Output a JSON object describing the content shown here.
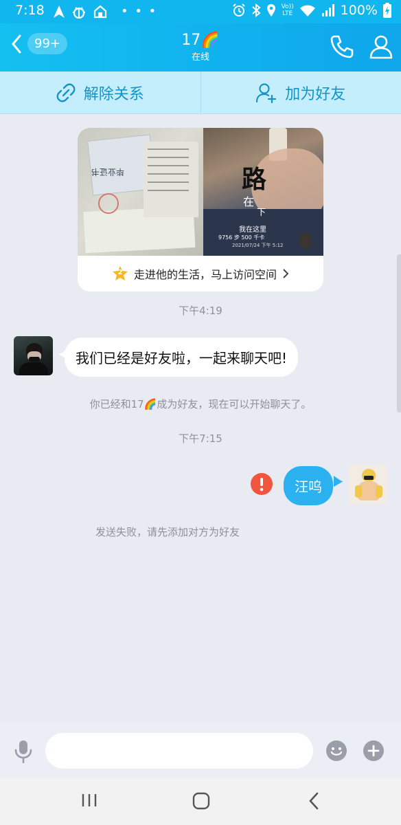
{
  "status_bar": {
    "time": "7:18",
    "battery": "100%",
    "left_icons": [
      "navigation-icon",
      "bug-icon",
      "home-icon",
      "more-dots-icon"
    ],
    "right_icons": [
      "alarm-icon",
      "bluetooth-icon",
      "location-icon",
      "volte-icon",
      "wifi-icon",
      "signal-icon",
      "battery-charging-icon"
    ],
    "volte_top": "Vo))",
    "volte_bottom": "LTE"
  },
  "header": {
    "unread_badge": "99+",
    "title": "17🌈",
    "status": "在线",
    "icons": [
      "back-chevron-icon",
      "phone-icon",
      "profile-icon"
    ],
    "color": "#12b6ee"
  },
  "action_bar": {
    "remove_label": "解除关系",
    "add_label": "加为好友",
    "color": "#1593c9"
  },
  "profile_card": {
    "footer_text": "走进他的生活，马上访问空间",
    "badge": "2",
    "left_photo_text": "毕业证书",
    "right_photo_big_char": "路",
    "right_photo_small_chars": [
      "在",
      "下"
    ],
    "right_photo_location": "我在这里",
    "right_photo_steps": "9756 步  500 千卡",
    "right_photo_date": "2021/07/24 下午 5:12"
  },
  "messages": {
    "time_1": "下午4:19",
    "incoming_text": "我们已经是好友啦，一起来聊天吧!",
    "system_friend": "你已经和17🌈成为好友，现在可以开始聊天了。",
    "time_2": "下午7:15",
    "outgoing_text": "汪呜",
    "send_failed": "发送失败，请先添加对方为好友"
  },
  "input_bar": {
    "placeholder": "",
    "icons": [
      "microphone-icon",
      "emoji-icon",
      "plus-icon"
    ]
  },
  "nav_bar": {
    "icons": [
      "recent-apps-icon",
      "home-button-icon",
      "back-nav-icon"
    ]
  },
  "colors": {
    "bubble_out": "#2bb0f0",
    "bubble_in": "#ffffff",
    "error": "#f0563e",
    "background": "#e9ebf3"
  }
}
